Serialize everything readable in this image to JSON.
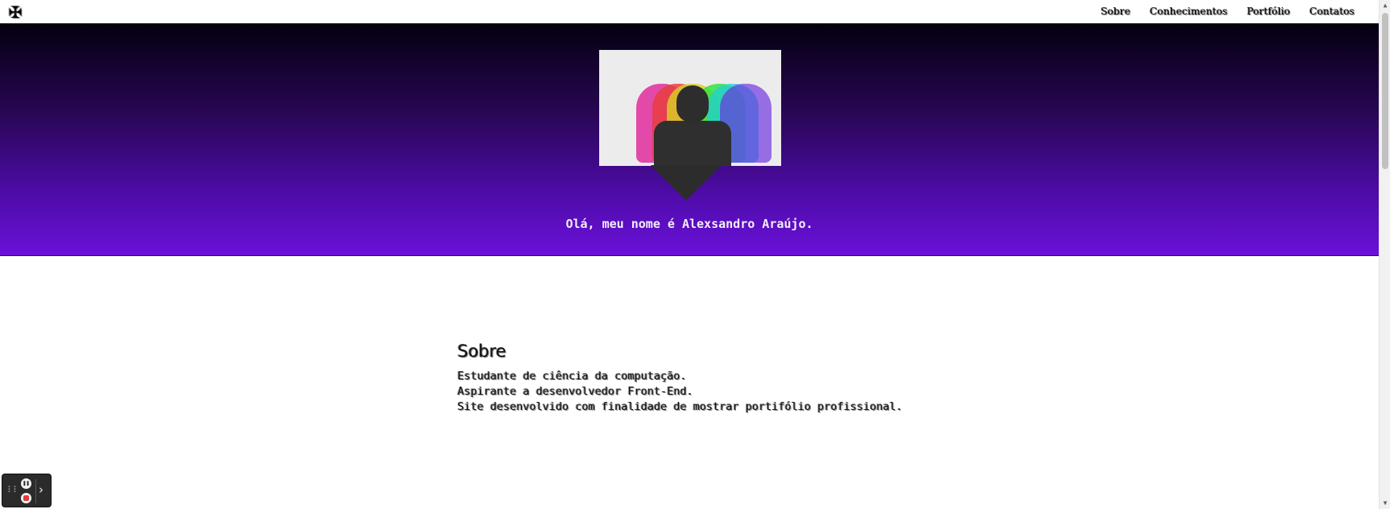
{
  "topbar": {
    "logo_glyph": "✠",
    "nav": [
      {
        "label": "Sobre"
      },
      {
        "label": "Conhecimentos"
      },
      {
        "label": "Portfólio"
      },
      {
        "label": "Contatos"
      }
    ]
  },
  "hero": {
    "greeting": "Olá, meu nome é Alexsandro Araújo."
  },
  "about": {
    "title": "Sobre",
    "lines": [
      "Estudante de ciência da computação.",
      "Aspirante a desenvolvedor Front-End.",
      "Site desenvolvido com finalidade de mostrar portifólio profissional."
    ]
  },
  "scrollbar": {
    "up_glyph": "▲",
    "down_glyph": "▼"
  },
  "recorder": {
    "grip_glyph": "⠇⠇",
    "pause_glyph": "❚❚",
    "expand_glyph": "›"
  },
  "colors": {
    "hero_top": "#04000f",
    "hero_bottom": "#6a11d8",
    "greeting_text": "#f3ecff"
  }
}
